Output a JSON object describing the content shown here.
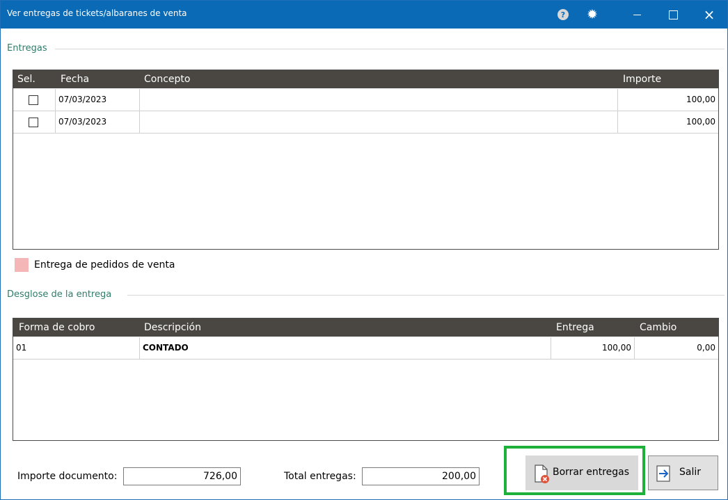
{
  "window": {
    "title": "Ver entregas de tickets/albaranes de venta",
    "help_icon": "?",
    "settings_icon": "gear-icon",
    "minimize_icon": "minimize-icon",
    "maximize_icon": "maximize-icon",
    "close_icon": "×"
  },
  "entregas": {
    "section_title": "Entregas",
    "columns": [
      "Sel.",
      "Fecha",
      "Concepto",
      "Importe"
    ],
    "rows": [
      {
        "selected": false,
        "fecha": "07/03/2023",
        "concepto": "",
        "importe": "100,00"
      },
      {
        "selected": false,
        "fecha": "07/03/2023",
        "concepto": "",
        "importe": "100,00"
      }
    ]
  },
  "legend": {
    "label": "Entrega de pedidos de venta",
    "color": "#f4b6b6"
  },
  "desglose": {
    "section_title": "Desglose de la entrega",
    "columns": [
      "Forma de cobro",
      "Descripción",
      "Entrega",
      "Cambio"
    ],
    "rows": [
      {
        "forma": "01",
        "descripcion": "CONTADO",
        "entrega": "100,00",
        "cambio": "0,00"
      }
    ]
  },
  "footer": {
    "importe_documento_label": "Importe documento:",
    "importe_documento_value": "726,00",
    "total_entregas_label": "Total entregas:",
    "total_entregas_value": "200,00",
    "borrar_label": "Borrar entregas",
    "salir_label": "Salir"
  },
  "colors": {
    "titlebar": "#0a6ab6",
    "section_text": "#2e7d6a",
    "grid_header": "#4a4742",
    "highlight": "#1db13a"
  }
}
